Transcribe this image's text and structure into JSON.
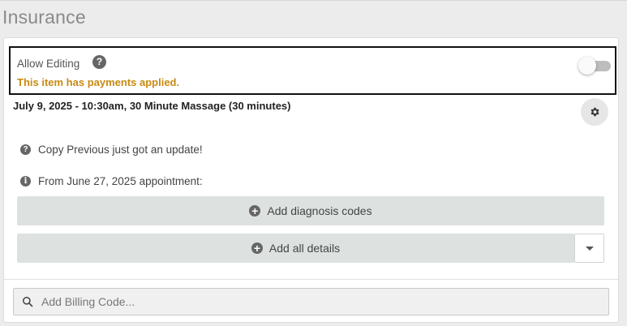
{
  "section": {
    "title": "Insurance"
  },
  "editing": {
    "label": "Allow Editing",
    "help_icon": "question-circle-icon",
    "help_glyph": "?",
    "payments_note": "This item has payments applied.",
    "toggle_on": false
  },
  "appointment": {
    "heading": "July 9, 2025 - 10:30am, 30 Minute Massage (30 minutes)",
    "settings_icon": "gear-icon"
  },
  "notices": [
    {
      "icon": "question-circle-icon",
      "glyph": "?",
      "text": "Copy Previous just got an update!"
    },
    {
      "icon": "info-circle-icon",
      "glyph": "i",
      "text": "From June 27, 2025 appointment:"
    }
  ],
  "actions": {
    "add_diagnosis_label": "Add diagnosis codes",
    "add_details_label": "Add all details",
    "plus_glyph": "+",
    "dropdown_icon": "caret-down-icon"
  },
  "billing": {
    "placeholder": "Add Billing Code...",
    "value": "",
    "search_icon": "search-icon"
  },
  "colors": {
    "warning": "#c98a12",
    "button_bg": "#dde2e1",
    "icon_gray": "#666666"
  }
}
